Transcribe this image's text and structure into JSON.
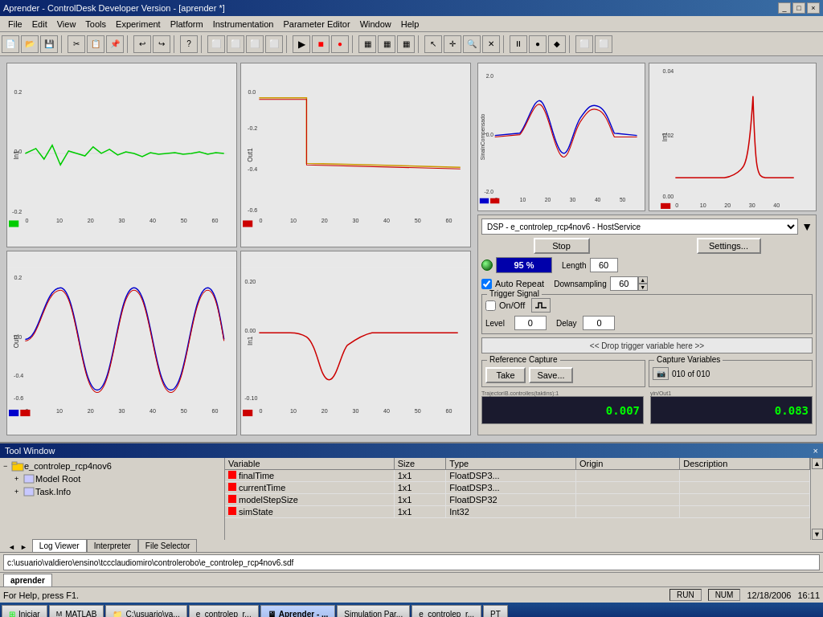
{
  "window": {
    "title": "Aprender - ControlDesk Developer Version - [aprender *]",
    "controls": [
      "_",
      "□",
      "×"
    ]
  },
  "menubar": {
    "items": [
      "File",
      "Edit",
      "View",
      "Tools",
      "Experiment",
      "Platform",
      "Instrumentation",
      "Parameter Editor",
      "Window",
      "Help"
    ]
  },
  "charts": {
    "top_left": {
      "ylabel": "In1",
      "ymax": "0.2",
      "ymin": "-0.2",
      "xmax": "60",
      "color": "#00cc00"
    },
    "top_mid": {
      "ylabel": "Out1",
      "ymax": "0.0",
      "ymin": "-0.6",
      "xmax": "60",
      "color": "#cc0000"
    },
    "top_right1": {
      "ylabel": "SinalnCompensado",
      "ymax": "2.0",
      "ymin": "-2.0",
      "xmax": "60"
    },
    "top_right2": {
      "ylabel": "In1",
      "ymax": "0.04",
      "ymin": "0.00",
      "xmax": "40"
    },
    "bot_left": {
      "ylabel": "Out1",
      "ymax": "0.2",
      "ymin": "-0.6",
      "xmax": "60"
    },
    "bot_mid": {
      "ylabel": "In1",
      "ymax": "0.20",
      "ymin": "-0.10",
      "xmax": "60"
    }
  },
  "control_panel": {
    "dsp_dropdown": "DSP - e_controlep_rcp4nov6 - HostService",
    "stop_btn": "Stop",
    "settings_btn": "Settings...",
    "progress": "95 %",
    "length_label": "Length",
    "length_value": "60",
    "auto_repeat_label": "Auto Repeat",
    "downsampling_label": "Downsampling",
    "downsampling_value": "60",
    "trigger_signal_label": "Trigger Signal",
    "onoff_label": "On/Off",
    "level_label": "Level",
    "level_value": "0",
    "delay_label": "Delay",
    "delay_value": "0",
    "drop_trigger_text": "<< Drop trigger variable here >>",
    "reference_capture_label": "Reference Capture",
    "take_btn": "Take",
    "save_btn": "Save...",
    "capture_vars_label": "Capture Variables",
    "capture_count": "010 of 010"
  },
  "display_boxes": {
    "left_label": "TrajectoriB.controlles(taktins):1",
    "left_value": "0.007",
    "right_label": "yin/Out1",
    "right_value": "0.083"
  },
  "tool_window": {
    "title": "Tool Window",
    "close": "×"
  },
  "tree": {
    "root": "e_controlep_rcp4nov6",
    "items": [
      "Model Root",
      "Task.Info"
    ]
  },
  "variable_table": {
    "headers": [
      "Variable",
      "Size",
      "Type",
      "Origin",
      "Description"
    ],
    "rows": [
      {
        "name": "finalTime",
        "size": "1x1",
        "type": "FloatDSP3...",
        "origin": "",
        "description": ""
      },
      {
        "name": "currentTime",
        "size": "1x1",
        "type": "FloatDSP3...",
        "origin": "",
        "description": ""
      },
      {
        "name": "modelStepSize",
        "size": "1x1",
        "type": "FloatDSP32",
        "origin": "",
        "description": ""
      },
      {
        "name": "simState",
        "size": "1x1",
        "type": "Int32",
        "origin": "",
        "description": ""
      }
    ]
  },
  "nav_tabs": {
    "items": [
      "Log Viewer",
      "Interpreter",
      "File Selector"
    ]
  },
  "pathbar": {
    "path": "c:\\usuario\\valdiero\\ensino\\tccclaudiomiro\\controlerobo\\e_controlep_rcp4nov6.sdf"
  },
  "active_tab": {
    "label": "aprender"
  },
  "statusbar": {
    "help_text": "For Help, press F1.",
    "run_status": "RUN",
    "num_indicator": "NUM",
    "date": "12/18/2006",
    "time": "16:11"
  },
  "taskbar": {
    "start_btn": "Iniciar",
    "items": [
      "MATLAB",
      "C:\\usuario\\va...",
      "e_controlep_r...",
      "Aprender - ...",
      "Simulation Par...",
      "e_controlep_r...",
      "PT"
    ]
  }
}
